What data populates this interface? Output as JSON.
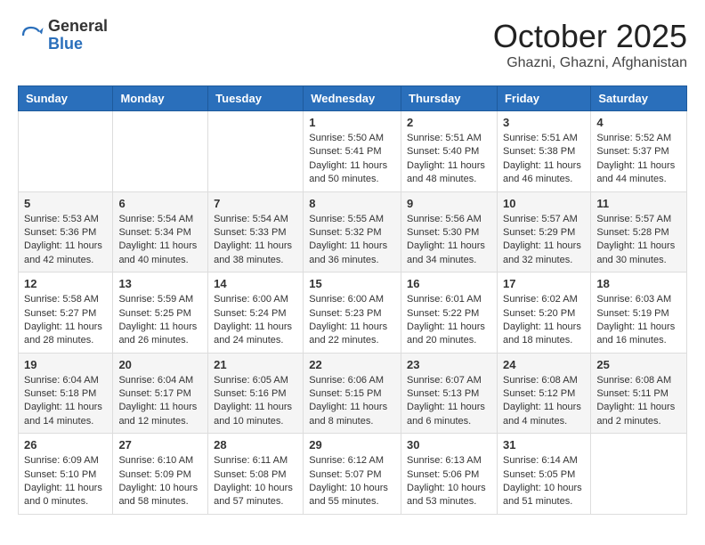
{
  "header": {
    "logo_general": "General",
    "logo_blue": "Blue",
    "month_title": "October 2025",
    "location": "Ghazni, Ghazni, Afghanistan"
  },
  "weekdays": [
    "Sunday",
    "Monday",
    "Tuesday",
    "Wednesday",
    "Thursday",
    "Friday",
    "Saturday"
  ],
  "weeks": [
    [
      {
        "day": "",
        "info": ""
      },
      {
        "day": "",
        "info": ""
      },
      {
        "day": "",
        "info": ""
      },
      {
        "day": "1",
        "info": "Sunrise: 5:50 AM\nSunset: 5:41 PM\nDaylight: 11 hours\nand 50 minutes."
      },
      {
        "day": "2",
        "info": "Sunrise: 5:51 AM\nSunset: 5:40 PM\nDaylight: 11 hours\nand 48 minutes."
      },
      {
        "day": "3",
        "info": "Sunrise: 5:51 AM\nSunset: 5:38 PM\nDaylight: 11 hours\nand 46 minutes."
      },
      {
        "day": "4",
        "info": "Sunrise: 5:52 AM\nSunset: 5:37 PM\nDaylight: 11 hours\nand 44 minutes."
      }
    ],
    [
      {
        "day": "5",
        "info": "Sunrise: 5:53 AM\nSunset: 5:36 PM\nDaylight: 11 hours\nand 42 minutes."
      },
      {
        "day": "6",
        "info": "Sunrise: 5:54 AM\nSunset: 5:34 PM\nDaylight: 11 hours\nand 40 minutes."
      },
      {
        "day": "7",
        "info": "Sunrise: 5:54 AM\nSunset: 5:33 PM\nDaylight: 11 hours\nand 38 minutes."
      },
      {
        "day": "8",
        "info": "Sunrise: 5:55 AM\nSunset: 5:32 PM\nDaylight: 11 hours\nand 36 minutes."
      },
      {
        "day": "9",
        "info": "Sunrise: 5:56 AM\nSunset: 5:30 PM\nDaylight: 11 hours\nand 34 minutes."
      },
      {
        "day": "10",
        "info": "Sunrise: 5:57 AM\nSunset: 5:29 PM\nDaylight: 11 hours\nand 32 minutes."
      },
      {
        "day": "11",
        "info": "Sunrise: 5:57 AM\nSunset: 5:28 PM\nDaylight: 11 hours\nand 30 minutes."
      }
    ],
    [
      {
        "day": "12",
        "info": "Sunrise: 5:58 AM\nSunset: 5:27 PM\nDaylight: 11 hours\nand 28 minutes."
      },
      {
        "day": "13",
        "info": "Sunrise: 5:59 AM\nSunset: 5:25 PM\nDaylight: 11 hours\nand 26 minutes."
      },
      {
        "day": "14",
        "info": "Sunrise: 6:00 AM\nSunset: 5:24 PM\nDaylight: 11 hours\nand 24 minutes."
      },
      {
        "day": "15",
        "info": "Sunrise: 6:00 AM\nSunset: 5:23 PM\nDaylight: 11 hours\nand 22 minutes."
      },
      {
        "day": "16",
        "info": "Sunrise: 6:01 AM\nSunset: 5:22 PM\nDaylight: 11 hours\nand 20 minutes."
      },
      {
        "day": "17",
        "info": "Sunrise: 6:02 AM\nSunset: 5:20 PM\nDaylight: 11 hours\nand 18 minutes."
      },
      {
        "day": "18",
        "info": "Sunrise: 6:03 AM\nSunset: 5:19 PM\nDaylight: 11 hours\nand 16 minutes."
      }
    ],
    [
      {
        "day": "19",
        "info": "Sunrise: 6:04 AM\nSunset: 5:18 PM\nDaylight: 11 hours\nand 14 minutes."
      },
      {
        "day": "20",
        "info": "Sunrise: 6:04 AM\nSunset: 5:17 PM\nDaylight: 11 hours\nand 12 minutes."
      },
      {
        "day": "21",
        "info": "Sunrise: 6:05 AM\nSunset: 5:16 PM\nDaylight: 11 hours\nand 10 minutes."
      },
      {
        "day": "22",
        "info": "Sunrise: 6:06 AM\nSunset: 5:15 PM\nDaylight: 11 hours\nand 8 minutes."
      },
      {
        "day": "23",
        "info": "Sunrise: 6:07 AM\nSunset: 5:13 PM\nDaylight: 11 hours\nand 6 minutes."
      },
      {
        "day": "24",
        "info": "Sunrise: 6:08 AM\nSunset: 5:12 PM\nDaylight: 11 hours\nand 4 minutes."
      },
      {
        "day": "25",
        "info": "Sunrise: 6:08 AM\nSunset: 5:11 PM\nDaylight: 11 hours\nand 2 minutes."
      }
    ],
    [
      {
        "day": "26",
        "info": "Sunrise: 6:09 AM\nSunset: 5:10 PM\nDaylight: 11 hours\nand 0 minutes."
      },
      {
        "day": "27",
        "info": "Sunrise: 6:10 AM\nSunset: 5:09 PM\nDaylight: 10 hours\nand 58 minutes."
      },
      {
        "day": "28",
        "info": "Sunrise: 6:11 AM\nSunset: 5:08 PM\nDaylight: 10 hours\nand 57 minutes."
      },
      {
        "day": "29",
        "info": "Sunrise: 6:12 AM\nSunset: 5:07 PM\nDaylight: 10 hours\nand 55 minutes."
      },
      {
        "day": "30",
        "info": "Sunrise: 6:13 AM\nSunset: 5:06 PM\nDaylight: 10 hours\nand 53 minutes."
      },
      {
        "day": "31",
        "info": "Sunrise: 6:14 AM\nSunset: 5:05 PM\nDaylight: 10 hours\nand 51 minutes."
      },
      {
        "day": "",
        "info": ""
      }
    ]
  ]
}
